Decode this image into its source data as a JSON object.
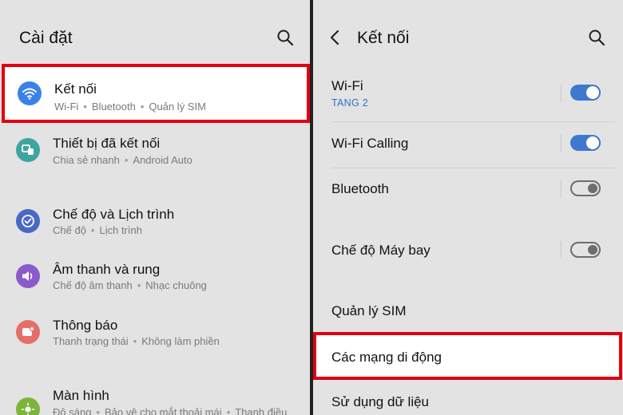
{
  "left": {
    "title": "Cài đặt",
    "items": [
      {
        "title": "Kết nối",
        "subs": [
          "Wi-Fi",
          "Bluetooth",
          "Quản lý SIM"
        ],
        "color": "#3a82e8"
      },
      {
        "title": "Thiết bị đã kết nối",
        "subs": [
          "Chia sẻ nhanh",
          "Android Auto"
        ],
        "color": "#3ea5a0"
      },
      {
        "title": "Chế độ và Lịch trình",
        "subs": [
          "Chế độ",
          "Lịch trình"
        ],
        "color": "#4968c7"
      },
      {
        "title": "Âm thanh và rung",
        "subs": [
          "Chế độ âm thanh",
          "Nhạc chuông"
        ],
        "color": "#8a5bcc"
      },
      {
        "title": "Thông báo",
        "subs": [
          "Thanh trạng thái",
          "Không làm phiền"
        ],
        "color": "#e56d6a"
      },
      {
        "title": "Màn hình",
        "subs": [
          "Độ sáng",
          "Bảo vệ cho mắt thoải mái",
          "Thanh điều"
        ],
        "color": "#7bb63a"
      }
    ]
  },
  "right": {
    "title": "Kết nối",
    "items": [
      {
        "title": "Wi-Fi",
        "sub": "TANG 2",
        "toggle": "on"
      },
      {
        "title": "Wi-Fi Calling",
        "sub": "",
        "toggle": "on"
      },
      {
        "title": "Bluetooth",
        "sub": "",
        "toggle": "off"
      },
      {
        "title": "Chế độ Máy bay",
        "sub": "",
        "toggle": "off"
      },
      {
        "title": "Quản lý SIM",
        "sub": "",
        "toggle": ""
      },
      {
        "title": "Các mạng di động",
        "sub": "",
        "toggle": ""
      },
      {
        "title": "Sử dụng dữ liệu",
        "sub": "",
        "toggle": ""
      }
    ]
  },
  "icons": {
    "search": "search-icon",
    "back": "back-arrow-icon",
    "wifi": "wifi-icon",
    "devices": "connected-devices-icon",
    "modes": "modes-check-icon",
    "sound": "speaker-icon",
    "notifications": "notification-icon",
    "display": "sun-icon"
  },
  "colors": {
    "highlight_border": "#e1000f",
    "toggle_on": "#3d79ce",
    "sub_accent": "#2a72c8"
  }
}
